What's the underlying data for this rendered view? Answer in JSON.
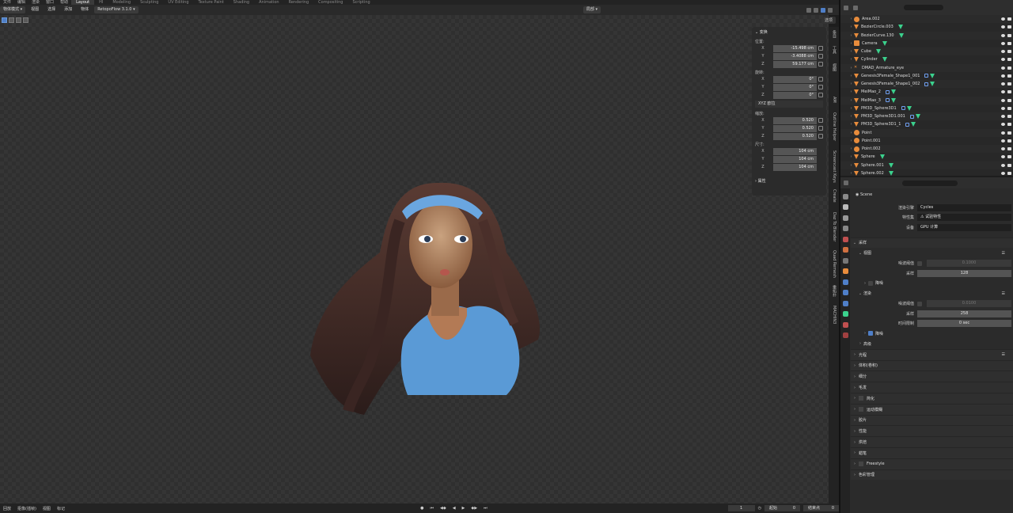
{
  "topbar": {
    "menus": [
      "文件",
      "编辑",
      "渲染",
      "窗口",
      "帮助"
    ],
    "workspaces": [
      "Layout",
      "HI",
      "Modeling",
      "Sculpting",
      "UV Editing",
      "Texture Paint",
      "Shading",
      "Animation",
      "Rendering",
      "Compositing",
      "Scripting"
    ],
    "active_workspace": "Layout",
    "scene": "Scene",
    "view_layer": "View Layer"
  },
  "viewport_header": {
    "mode": "物体模式",
    "menus": [
      "视图",
      "选择",
      "添加",
      "物体"
    ],
    "retopoflow": "RetopoFlow 3.1.0",
    "transform_orientation": "局部",
    "options": "选项"
  },
  "npanel": {
    "transform_title": "变换",
    "location_label": "位置:",
    "location": {
      "x": "-15.498 cm",
      "y": "-3.4088 cm",
      "z": "59.177 cm"
    },
    "rotation_label": "旋转:",
    "rotation": {
      "x": "0°",
      "y": "0°",
      "z": "0°"
    },
    "rotation_mode": "XYZ 欧拉",
    "scale_label": "缩放:",
    "scale": {
      "x": "0.520",
      "y": "0.520",
      "z": "0.520"
    },
    "dimensions_label": "尺寸:",
    "dimensions": {
      "x": "104 cm",
      "y": "104 cm",
      "z": "104 cm"
    },
    "properties_title": "属性",
    "axis": {
      "x": "X",
      "y": "Y",
      "z": "Z"
    }
  },
  "vtabs": [
    "条目",
    "工具",
    "视图",
    "AM",
    "Outline Helper",
    "Screencast Keys",
    "Create",
    "Daz To Blender",
    "Quad Remesh",
    "重拓扑",
    "MACHIN3"
  ],
  "timeline": {
    "playback": "回放",
    "keying": "抠像(插帧)",
    "view": "视图",
    "marker": "标记",
    "current_frame": "1",
    "start_label": "起始",
    "start": "0",
    "end_label": "结束点",
    "end": "0"
  },
  "outliner": {
    "items": [
      {
        "name": "Area.002",
        "icon": "light"
      },
      {
        "name": "BezierCircle.003",
        "icon": "mesh"
      },
      {
        "name": "BezierCurve.130",
        "icon": "mesh"
      },
      {
        "name": "Camera",
        "icon": "cam"
      },
      {
        "name": "Cube",
        "icon": "mesh"
      },
      {
        "name": "Cylinder",
        "icon": "mesh"
      },
      {
        "name": "DMAD_Armature_eye",
        "icon": "arm"
      },
      {
        "name": "Genesis3Female_Shape1_001",
        "icon": "mesh"
      },
      {
        "name": "Genesis3Female_Shape1_002",
        "icon": "mesh"
      },
      {
        "name": "MeiMao_2",
        "icon": "mesh"
      },
      {
        "name": "MeiMao_3",
        "icon": "mesh"
      },
      {
        "name": "PM3D_Sphere3D1",
        "icon": "mesh"
      },
      {
        "name": "PM3D_Sphere3D1.001",
        "icon": "mesh"
      },
      {
        "name": "PM3D_Sphere3D1_1",
        "icon": "mesh"
      },
      {
        "name": "Point",
        "icon": "light"
      },
      {
        "name": "Point.001",
        "icon": "light"
      },
      {
        "name": "Point.002",
        "icon": "light"
      },
      {
        "name": "Sphere",
        "icon": "mesh"
      },
      {
        "name": "Sphere.001",
        "icon": "mesh"
      },
      {
        "name": "Sphere.002",
        "icon": "mesh"
      }
    ]
  },
  "properties": {
    "scene_name": "Scene",
    "render_engine_label": "渲染引擎",
    "render_engine": "Cycles",
    "feature_set_label": "特性集",
    "feature_set": "试验特性",
    "device_label": "设备",
    "device": "GPU 计算",
    "sampling": "采样",
    "viewport": "视图",
    "noise_threshold_label": "噪波阈值",
    "viewport_noise_threshold": "0.1000",
    "samples_label": "采样",
    "viewport_samples": "128",
    "denoise": "降噪",
    "render": "渲染",
    "render_noise_threshold": "0.0100",
    "render_samples": "258",
    "time_limit_label": "时间限制",
    "time_limit": "0 sec",
    "advanced": "高级",
    "panels": [
      "光程",
      "体积(卷积)",
      "细分",
      "毛发",
      "简化",
      "运动模糊",
      "胶片",
      "性能",
      "烘焙",
      "蜡笔",
      "Freestyle",
      "色彩管理"
    ]
  },
  "colors": {
    "accent": "#4f7fc8",
    "object_orange": "#e88c3c",
    "data_green": "#3bd18d"
  }
}
